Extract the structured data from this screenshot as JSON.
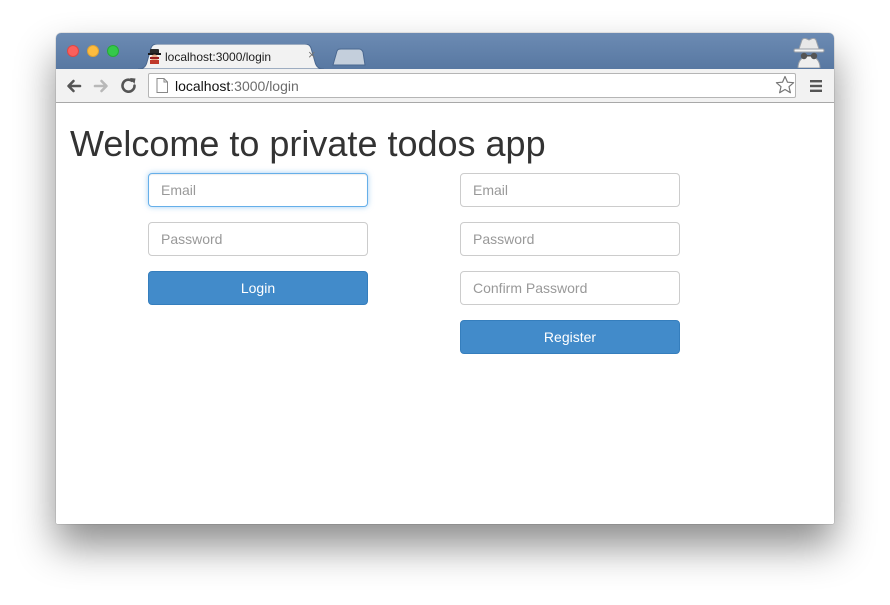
{
  "browser": {
    "tab_title": "localhost:3000/login",
    "tab_close_glyph": "×",
    "url_host": "localhost",
    "url_path": ":3000/login",
    "icons": {
      "favicon": "spy-favicon-icon",
      "incognito": "incognito-icon",
      "back": "back-arrow-icon",
      "forward": "forward-arrow-icon",
      "reload": "reload-icon",
      "page": "page-icon",
      "bookmark": "star-icon",
      "menu": "hamburger-menu-icon"
    }
  },
  "page": {
    "heading": "Welcome to private todos app",
    "login": {
      "email_placeholder": "Email",
      "password_placeholder": "Password",
      "submit_label": "Login"
    },
    "register": {
      "email_placeholder": "Email",
      "password_placeholder": "Password",
      "confirm_placeholder": "Confirm Password",
      "submit_label": "Register"
    }
  },
  "colors": {
    "primary_button": "#428bca",
    "focus_border": "#66afe9",
    "heading_text": "#333333"
  }
}
